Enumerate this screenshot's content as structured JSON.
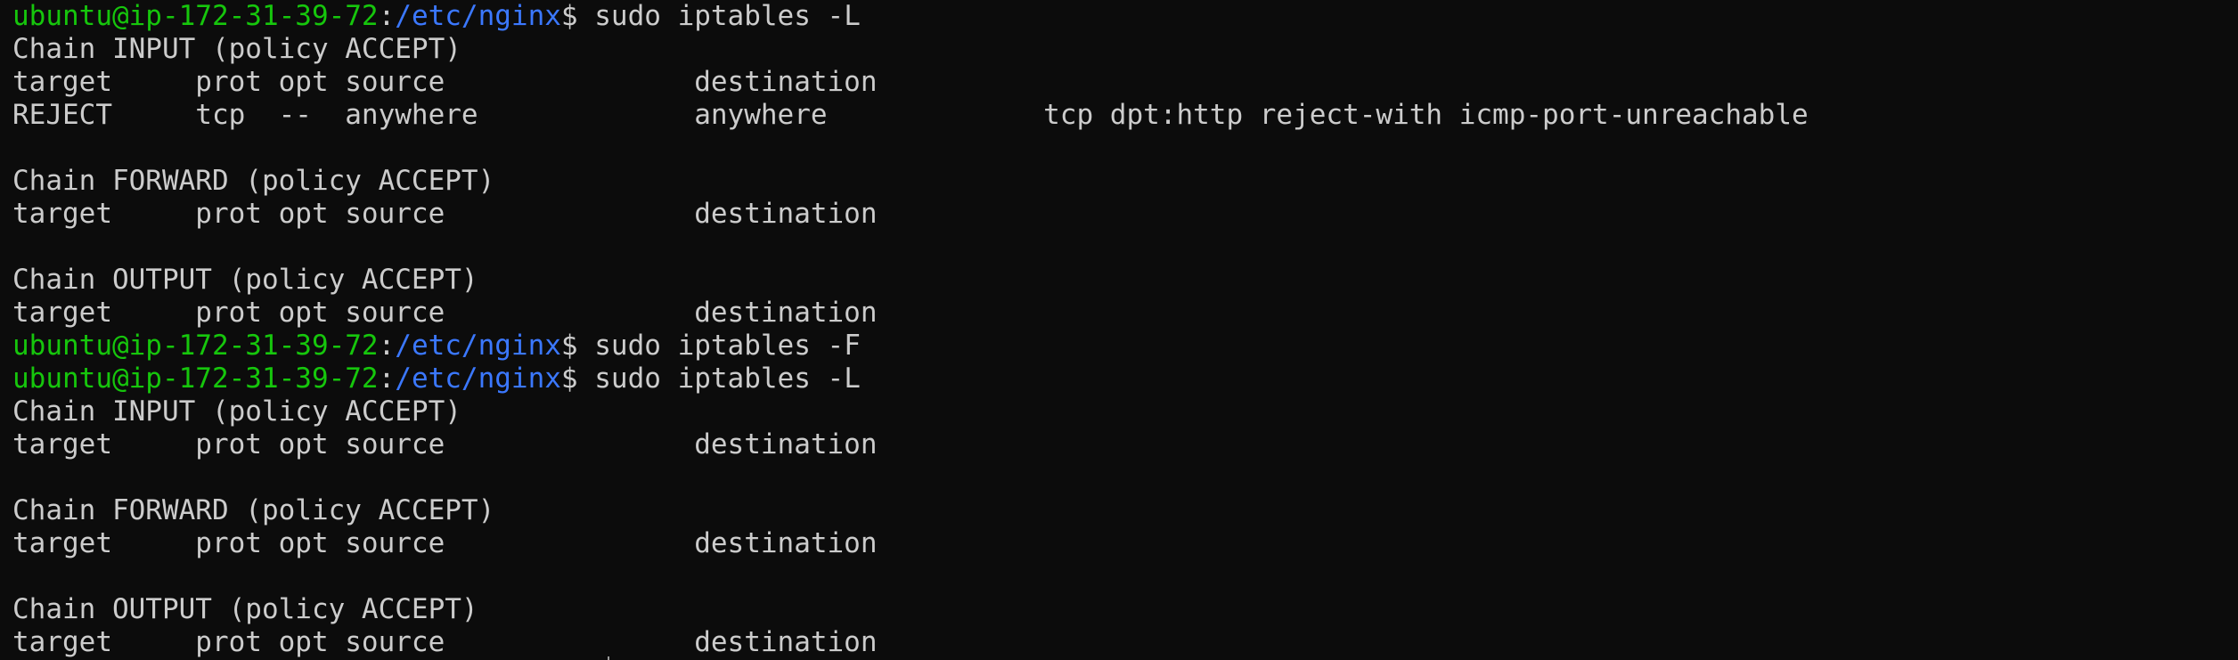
{
  "theme": {
    "background": "#0c0c0c",
    "foreground": "#cccccc",
    "user_host_color": "#16c60c",
    "path_color": "#3b78ff"
  },
  "prompt": {
    "user_host": "ubuntu@ip-172-31-39-72",
    "colon": ":",
    "path": "/etc/nginx",
    "symbol": "$ "
  },
  "lines": [
    {
      "type": "command",
      "text": "sudo iptables -L"
    },
    {
      "type": "output",
      "text": "Chain INPUT (policy ACCEPT)"
    },
    {
      "type": "output",
      "text": "target     prot opt source               destination"
    },
    {
      "type": "output",
      "text": "REJECT     tcp  --  anywhere             anywhere             tcp dpt:http reject-with icmp-port-unreachable"
    },
    {
      "type": "output",
      "text": ""
    },
    {
      "type": "output",
      "text": "Chain FORWARD (policy ACCEPT)"
    },
    {
      "type": "output",
      "text": "target     prot opt source               destination"
    },
    {
      "type": "output",
      "text": ""
    },
    {
      "type": "output",
      "text": "Chain OUTPUT (policy ACCEPT)"
    },
    {
      "type": "output",
      "text": "target     prot opt source               destination"
    },
    {
      "type": "command",
      "text": "sudo iptables -F"
    },
    {
      "type": "command",
      "text": "sudo iptables -L"
    },
    {
      "type": "output",
      "text": "Chain INPUT (policy ACCEPT)"
    },
    {
      "type": "output",
      "text": "target     prot opt source               destination"
    },
    {
      "type": "output",
      "text": ""
    },
    {
      "type": "output",
      "text": "Chain FORWARD (policy ACCEPT)"
    },
    {
      "type": "output",
      "text": "target     prot opt source               destination"
    },
    {
      "type": "output",
      "text": ""
    },
    {
      "type": "output",
      "text": "Chain OUTPUT (policy ACCEPT)"
    },
    {
      "type": "output",
      "text": "target     prot opt source               destination"
    }
  ]
}
